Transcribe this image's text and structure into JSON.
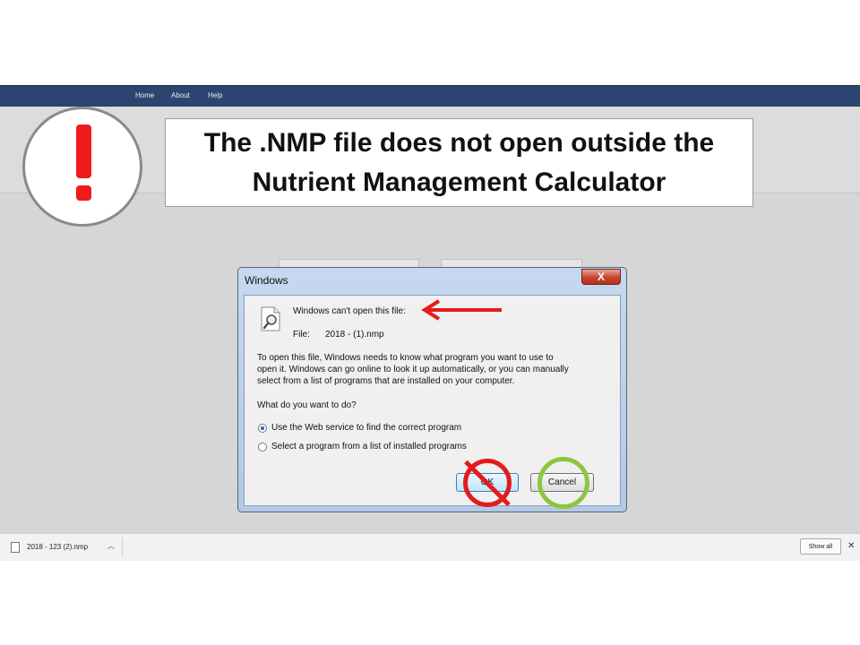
{
  "nav": {
    "items": [
      "Home",
      "About",
      "Help"
    ]
  },
  "callout": {
    "line1": "The .NMP file does not open outside the",
    "line2": "Nutrient Management Calculator"
  },
  "warning": {
    "icon": "exclamation-icon",
    "color": "#ee1c1c"
  },
  "dialog": {
    "title": "Windows",
    "close_label": "X",
    "heading": "Windows can't open this file:",
    "file_label": "File:",
    "file_name": "2018 - (1).nmp",
    "para_line1": "To open this file, Windows needs to know what program you want to use to",
    "para_line2": "open it. Windows can go online to look it up automatically, or you can manually",
    "para_line3": "select from a list of programs that are installed on your computer.",
    "question": "What do you want to do?",
    "option_web": "Use the Web service to find the correct program",
    "option_list": "Select a program from a list of installed programs",
    "ok_label": "OK",
    "cancel_label": "Cancel"
  },
  "annotations": {
    "arrow_color": "#e41b1b",
    "reject_color": "#e41b1b",
    "accept_color": "#8cc63f"
  },
  "download_bar": {
    "file_name": "2018 - 123 (2).nmp",
    "show_all": "Show all",
    "close": "✕"
  }
}
